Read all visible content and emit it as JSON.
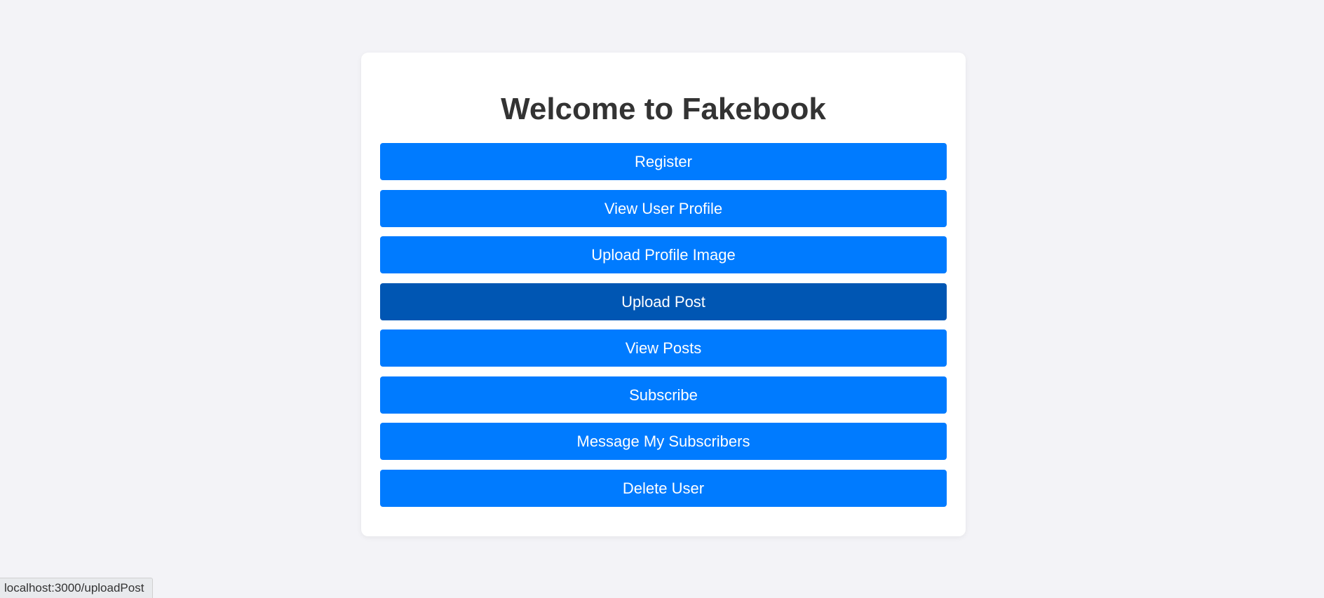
{
  "page": {
    "title": "Welcome to Fakebook"
  },
  "buttons": [
    {
      "label": "Register",
      "state": "normal"
    },
    {
      "label": "View User Profile",
      "state": "normal"
    },
    {
      "label": "Upload Profile Image",
      "state": "normal"
    },
    {
      "label": "Upload Post",
      "state": "hover"
    },
    {
      "label": "View Posts",
      "state": "normal"
    },
    {
      "label": "Subscribe",
      "state": "normal"
    },
    {
      "label": "Message My Subscribers",
      "state": "normal"
    },
    {
      "label": "Delete User",
      "state": "normal"
    }
  ],
  "status_bar": {
    "url": "localhost:3000/uploadPost"
  },
  "colors": {
    "background": "#f3f3f7",
    "card": "#ffffff",
    "button": "#007bff",
    "button_hover": "#0056b3",
    "title_text": "#333333"
  }
}
